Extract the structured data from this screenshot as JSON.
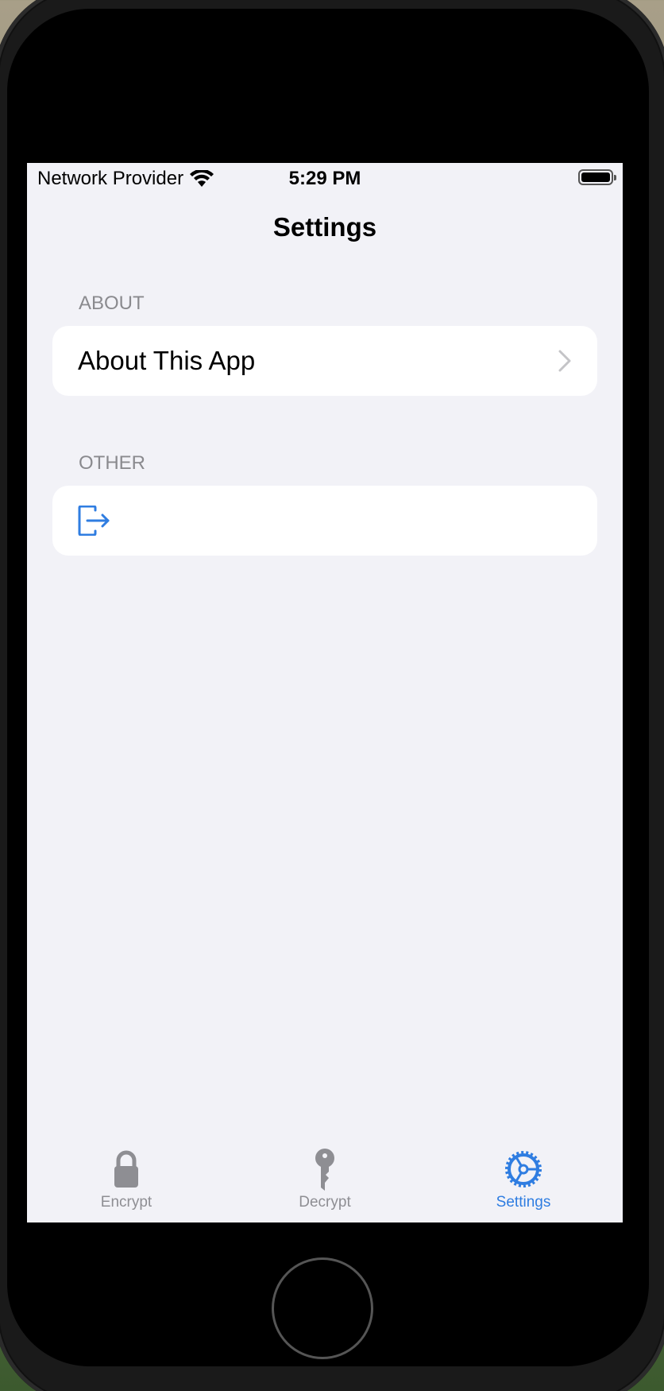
{
  "status_bar": {
    "carrier": "Network Provider",
    "time": "5:29 PM"
  },
  "nav": {
    "title": "Settings"
  },
  "sections": {
    "about": {
      "header": "ABOUT",
      "row_label": "About This App"
    },
    "other": {
      "header": "OTHER",
      "row_icon": "logout-icon"
    }
  },
  "tabbar": {
    "items": [
      {
        "label": "Encrypt",
        "icon": "lock-icon",
        "selected": false
      },
      {
        "label": "Decrypt",
        "icon": "key-icon",
        "selected": false
      },
      {
        "label": "Settings",
        "icon": "gear-icon",
        "selected": true
      }
    ]
  },
  "colors": {
    "accent": "#2f7de1",
    "inactive": "#8e8e93",
    "background": "#f2f2f7",
    "card": "#ffffff"
  }
}
